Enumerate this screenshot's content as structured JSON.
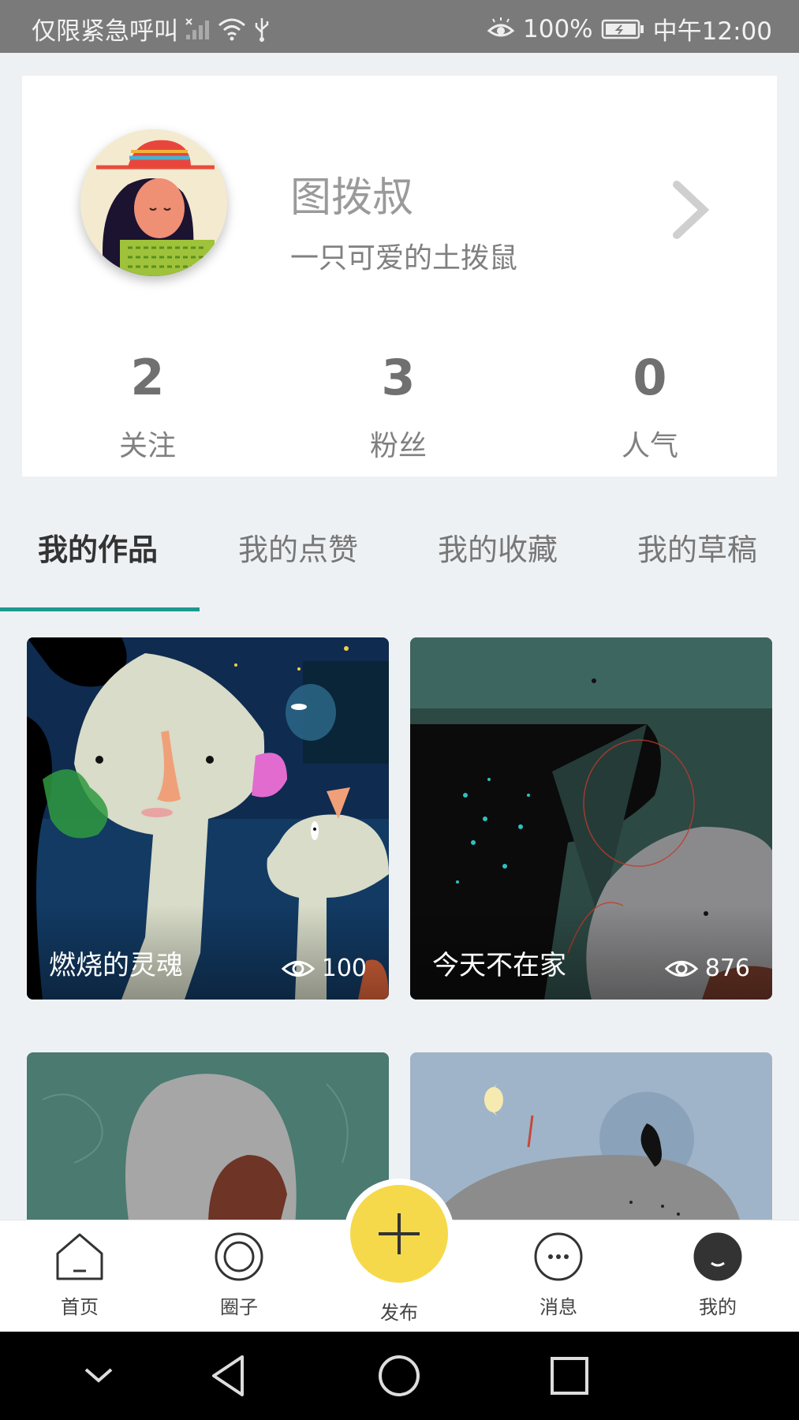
{
  "status_bar": {
    "carrier": "仅限紧急呼叫",
    "battery": "100%",
    "time": "中午12:00"
  },
  "profile": {
    "name": "图拨叔",
    "bio": "一只可爱的土拨鼠",
    "stats": [
      {
        "value": "2",
        "label": "关注"
      },
      {
        "value": "3",
        "label": "粉丝"
      },
      {
        "value": "0",
        "label": "人气"
      }
    ]
  },
  "tabs": [
    "我的作品",
    "我的点赞",
    "我的收藏",
    "我的草稿"
  ],
  "works": [
    {
      "title": "燃烧的灵魂",
      "views": "100"
    },
    {
      "title": "今天不在家",
      "views": "876"
    }
  ],
  "bottom_nav": {
    "home": "首页",
    "circle": "圈子",
    "publish": "发布",
    "messages": "消息",
    "mine": "我的"
  },
  "colors": {
    "accent": "#1d9a8e",
    "fab": "#f5d94a"
  }
}
